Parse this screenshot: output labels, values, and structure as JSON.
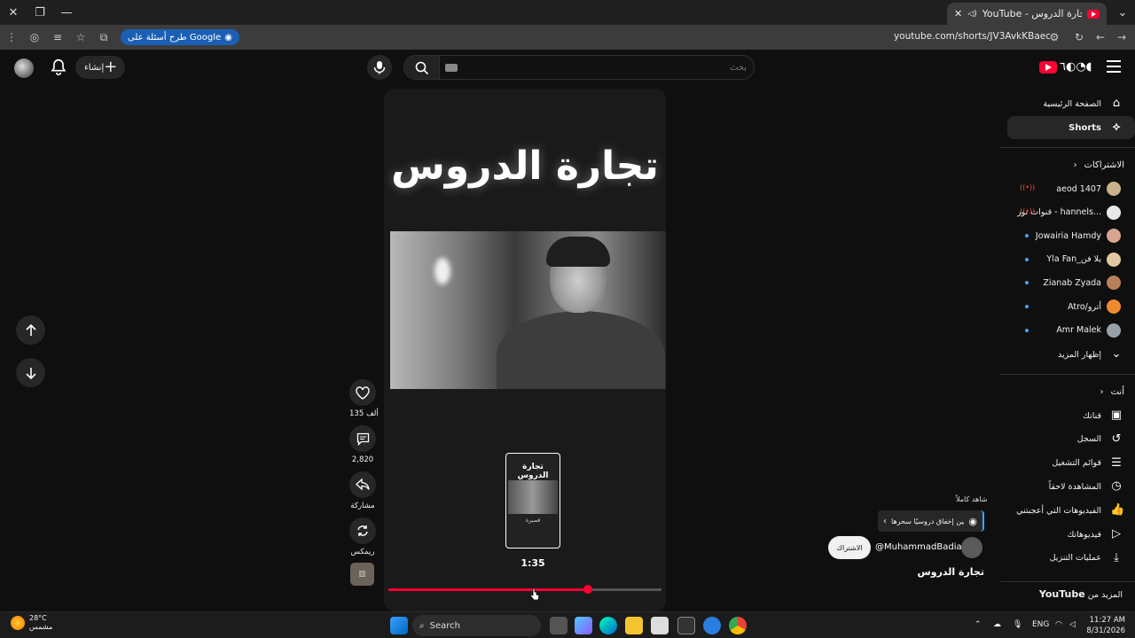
{
  "browser": {
    "tab_title": "YouTube - تجارة الدروس",
    "url": "youtube.com/shorts/JV3AvkKBaec",
    "google_chip_label": "طرح أسئلة على Google"
  },
  "header": {
    "create_label": "إنشاء",
    "search_placeholder": "بحث",
    "logo_text": "YouTube"
  },
  "sidebar": {
    "main_items": [
      {
        "label": "الصفحة الرئيسية",
        "icon": "home-icon"
      },
      {
        "label": "Shorts",
        "icon": "shorts-icon"
      }
    ],
    "subscriptions_title": "الاشتراكات",
    "subscriptions": [
      {
        "label": "aeod 1407",
        "marker": "live",
        "avatar_color": "#c9b28a"
      },
      {
        "label": "قنوات نور - hannels...",
        "marker": "live",
        "avatar_color": "#e8e8e8"
      },
      {
        "label": "Jowairia Hamdy",
        "marker": "dot",
        "avatar_color": "#d8a48f"
      },
      {
        "label": "Yla Fan_يلا فن",
        "marker": "dot",
        "avatar_color": "#e0c8a0"
      },
      {
        "label": "Zianab Zyada",
        "marker": "dot",
        "avatar_color": "#b97e5a"
      },
      {
        "label": "Atro/أترو",
        "marker": "dot",
        "avatar_color": "#f08a2e"
      },
      {
        "label": "Amr Malek",
        "marker": "dot",
        "avatar_color": "#9aa0a8"
      }
    ],
    "show_more": "إظهار المزيد",
    "you_title": "أنت",
    "you_items": [
      {
        "label": "قناتك",
        "icon": "channel-icon"
      },
      {
        "label": "السجل",
        "icon": "history-icon"
      },
      {
        "label": "قوائم التشغيل",
        "icon": "playlists-icon"
      },
      {
        "label": "المشاهدة لاحقاً",
        "icon": "watch-later-icon"
      },
      {
        "label": "الفيديوهات التي أعجبتني",
        "icon": "like-icon"
      },
      {
        "label": "فيديوهاتك",
        "icon": "your-videos-icon"
      },
      {
        "label": "عمليات التنزيل",
        "icon": "download-icon"
      }
    ],
    "more_from": "المزيد من",
    "more_from_brand": "YouTube"
  },
  "player": {
    "title_text": "تجارة الدروس",
    "thumb_title": "تجارة الدروس",
    "thumb_caption": "قصيرة",
    "time": "1:35",
    "progress": 0.73
  },
  "actions": {
    "likes": "135 ألف",
    "comments": "2,820",
    "share": "مشاركة",
    "remix": "ريمكس"
  },
  "overlay": {
    "label": "شاهد كاملاً",
    "card_text": "يتسمين إخفاق دروسيًا سحرها",
    "subscribe": "الاشتراك",
    "channel": "@MuhammadBadia22",
    "video_title": "تجارة الدروس"
  },
  "taskbar": {
    "temperature": "28°C",
    "weather": "مشمس",
    "search": "Search",
    "lang": "ENG",
    "time": "11:27 AM",
    "date": "8/31/2026"
  }
}
